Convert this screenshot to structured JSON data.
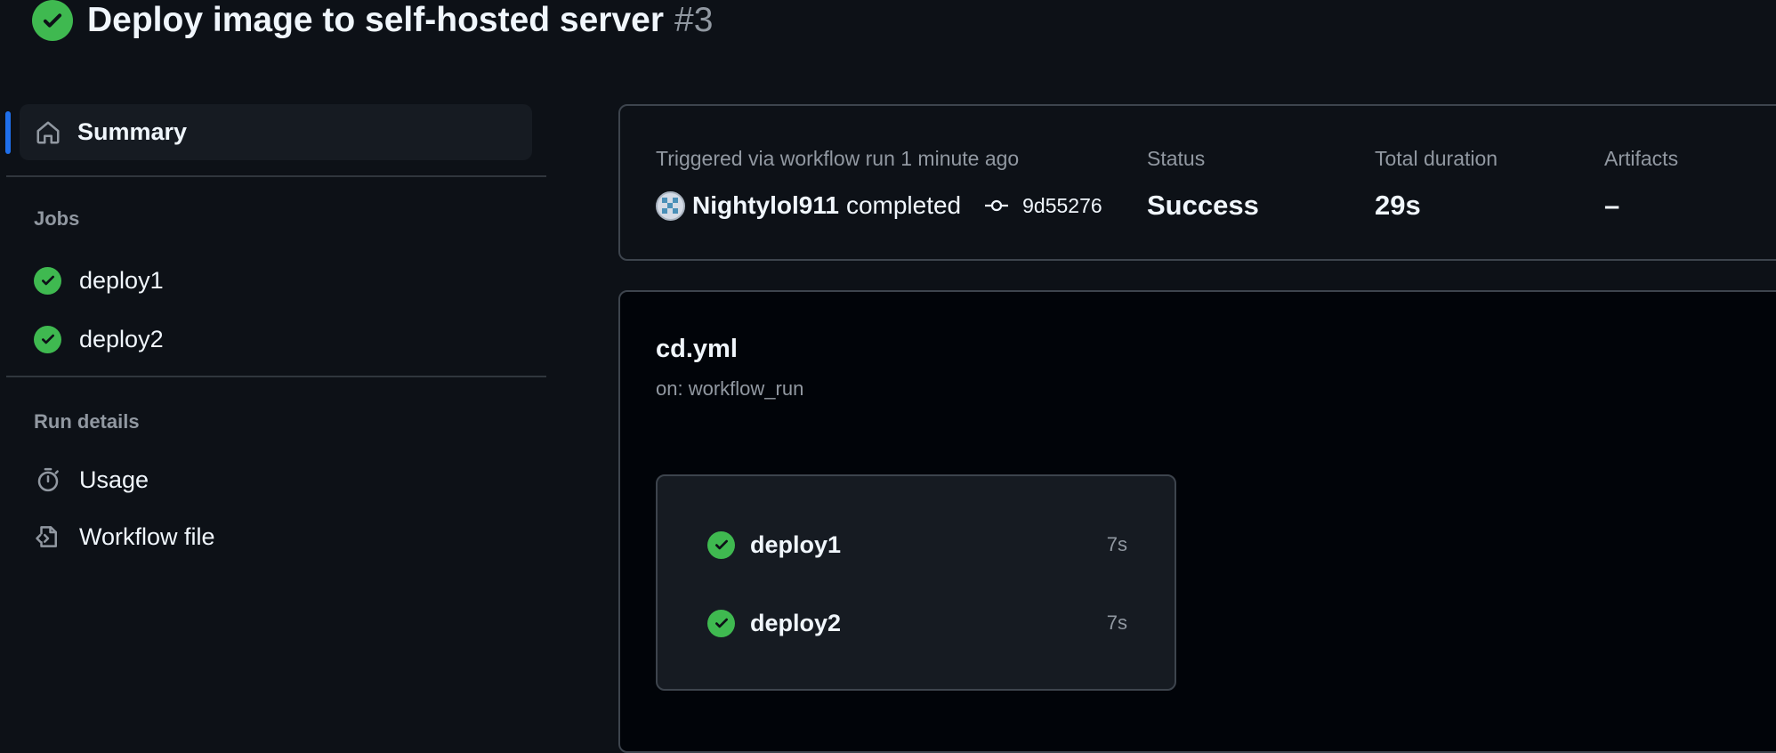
{
  "header": {
    "title": "Deploy image to self-hosted server",
    "run_number": "#3",
    "status_icon": "check-circle-fill-icon"
  },
  "sidebar": {
    "summary": {
      "label": "Summary",
      "icon": "home-icon",
      "active": true
    },
    "jobs_title": "Jobs",
    "jobs": [
      {
        "label": "deploy1",
        "icon": "check-circle-fill-icon"
      },
      {
        "label": "deploy2",
        "icon": "check-circle-fill-icon"
      }
    ],
    "run_details_title": "Run details",
    "run_details": [
      {
        "label": "Usage",
        "icon": "stopwatch-icon"
      },
      {
        "label": "Workflow file",
        "icon": "file-code-icon"
      }
    ]
  },
  "summary_card": {
    "trigger_text": "Triggered via workflow run 1 minute ago",
    "user": "Nightylol911",
    "action": "completed",
    "commit": "9d55276",
    "status_label": "Status",
    "status_value": "Success",
    "duration_label": "Total duration",
    "duration_value": "29s",
    "artifacts_label": "Artifacts",
    "artifacts_value": "–"
  },
  "workflow_graph": {
    "file_name": "cd.yml",
    "trigger": "on: workflow_run",
    "jobs": [
      {
        "name": "deploy1",
        "duration": "7s",
        "status": "success"
      },
      {
        "name": "deploy2",
        "duration": "7s",
        "status": "success"
      }
    ]
  },
  "colors": {
    "background": "#0d1117",
    "panel": "#161b22",
    "graph_background": "#010409",
    "border": "#3d444d",
    "success": "#3fb950",
    "accent": "#1f6feb",
    "muted_text": "#9198a1",
    "text": "#f0f6fc"
  }
}
